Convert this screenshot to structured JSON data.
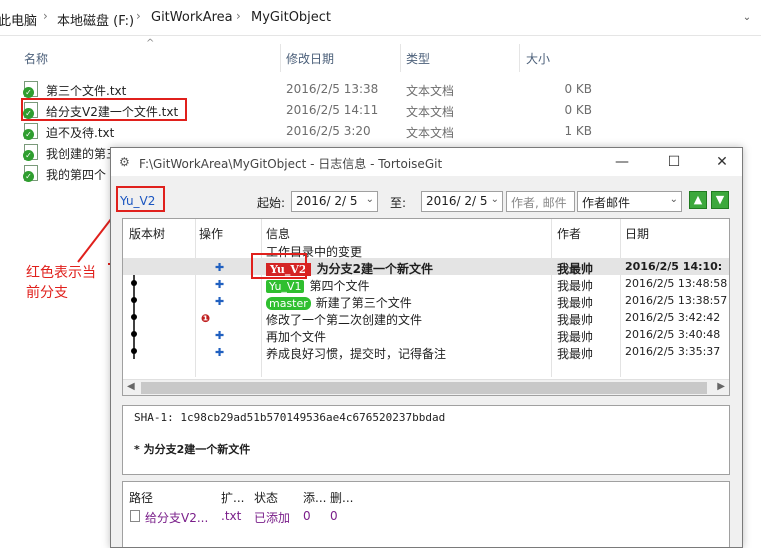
{
  "explorer": {
    "breadcrumb": [
      "此电脑",
      "本地磁盘 (F:)",
      "GitWorkArea",
      "MyGitObject"
    ],
    "columns": {
      "name": "名称",
      "date": "修改日期",
      "type": "类型",
      "size": "大小"
    },
    "files": [
      {
        "name": "第三个文件.txt",
        "date": "2016/2/5 13:38",
        "type": "文本文档",
        "size": "0 KB"
      },
      {
        "name": "给分支V2建一个文件.txt",
        "date": "2016/2/5 14:11",
        "type": "文本文档",
        "size": "0 KB"
      },
      {
        "name": "迫不及待.txt",
        "date": "2016/2/5 3:20",
        "type": "文本文档",
        "size": "1 KB"
      },
      {
        "name": "我创建的第三",
        "date": "",
        "type": "",
        "size": ""
      },
      {
        "name": "我的第四个",
        "date": "",
        "type": "",
        "size": ""
      }
    ]
  },
  "dialog": {
    "title": "F:\\GitWorkArea\\MyGitObject - 日志信息 - TortoiseGit",
    "branch": "Yu_V2",
    "from_label": "起始:",
    "from_date": "2016/ 2/ 5",
    "to_label": "至:",
    "to_date": "2016/ 2/ 5",
    "search_placeholder": "作者, 邮件",
    "filter_value": "作者邮件",
    "log_columns": {
      "graph": "版本树",
      "actions": "操作",
      "message": "信息",
      "author": "作者",
      "date": "日期"
    },
    "log_rows": [
      {
        "message": "工作目录中的变更",
        "author": "",
        "date": ""
      },
      {
        "tag": "Yu_V2",
        "message": "为分支2建一个新文件",
        "author": "我最帅",
        "date": "2016/2/5 14:10:"
      },
      {
        "tag": "Yu_V1",
        "message": "第四个文件",
        "author": "我最帅",
        "date": "2016/2/5 13:48:58"
      },
      {
        "tag": "master",
        "message": "新建了第三个文件",
        "author": "我最帅",
        "date": "2016/2/5 13:38:57"
      },
      {
        "message": "修改了一个第二次创建的文件",
        "author": "我最帅",
        "date": "2016/2/5 3:42:42"
      },
      {
        "message": "再加个文件",
        "author": "我最帅",
        "date": "2016/2/5 3:40:48"
      },
      {
        "message": "养成良好习惯，提交时，记得备注",
        "author": "我最帅",
        "date": "2016/2/5 3:35:37"
      }
    ],
    "sha": "SHA-1: 1c98cb29ad51b570149536ae4c676520237bbdad",
    "commit_message": "* 为分支2建一个新文件",
    "file_columns": {
      "path": "路径",
      "ext": "扩...",
      "status": "状态",
      "add": "添...",
      "del": "删..."
    },
    "changed_file": {
      "path": "给分支V2...",
      "ext": ".txt",
      "status": "已添加",
      "add": "0",
      "del": "0"
    }
  },
  "annotation": "红色表示当前分支",
  "colors": {
    "highlight_red": "#e0201c",
    "tag_green": "#2fbf2f",
    "current_branch_red": "#d42424"
  }
}
